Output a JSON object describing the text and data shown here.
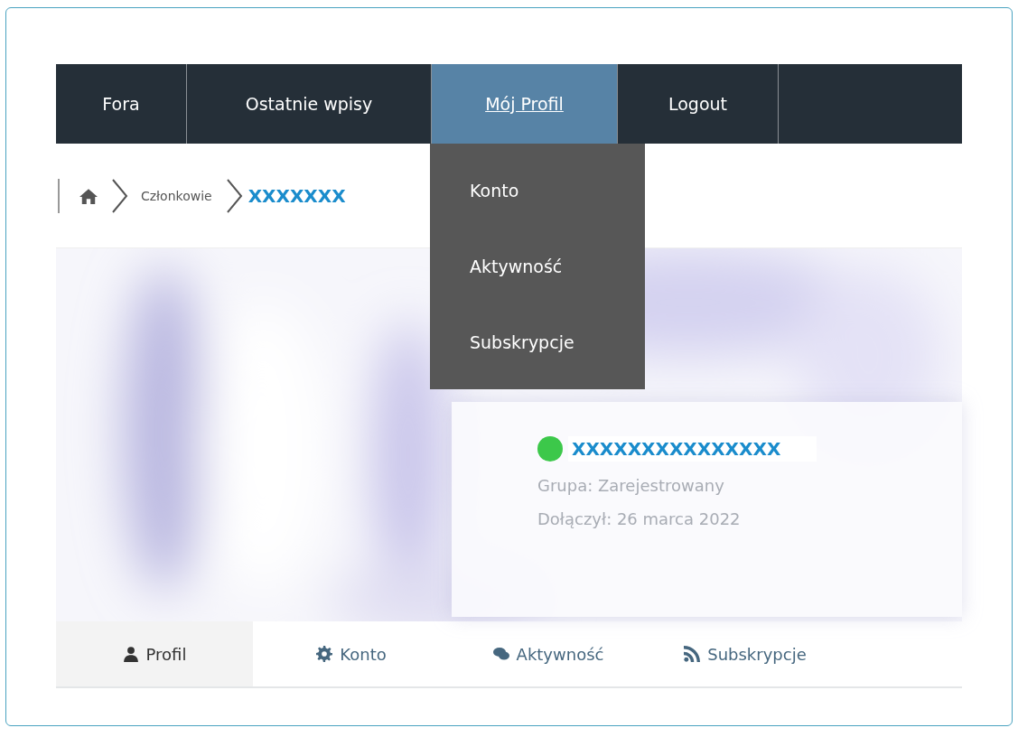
{
  "nav": {
    "items": [
      {
        "label": "Fora",
        "selected": false
      },
      {
        "label": "Ostatnie wpisy",
        "selected": false
      },
      {
        "label": "Mój Profil",
        "selected": true
      },
      {
        "label": "Logout",
        "selected": false
      }
    ],
    "dropdown": {
      "items": [
        "Konto",
        "Aktywność",
        "Subskrypcje"
      ]
    }
  },
  "breadcrumb": {
    "items": [
      "Członkowie",
      "XXXXXXX"
    ]
  },
  "profile": {
    "kind": "picture",
    "online": true,
    "color": "#3cc84a",
    "username": "XXXXXXXXXXXXXXX",
    "group": "Grupa: Zarejestrowany",
    "joined": "Dołączył: 26 marca 2022"
  },
  "tabs": [
    {
      "kind": "user",
      "label": "Profil",
      "selected": true
    },
    {
      "kind": "gear",
      "label": "Konto",
      "selected": false
    },
    {
      "kind": "chat",
      "label": "Aktywność",
      "selected": false
    },
    {
      "kind": "rss",
      "label": "Subskrypcje",
      "selected": false
    }
  ]
}
